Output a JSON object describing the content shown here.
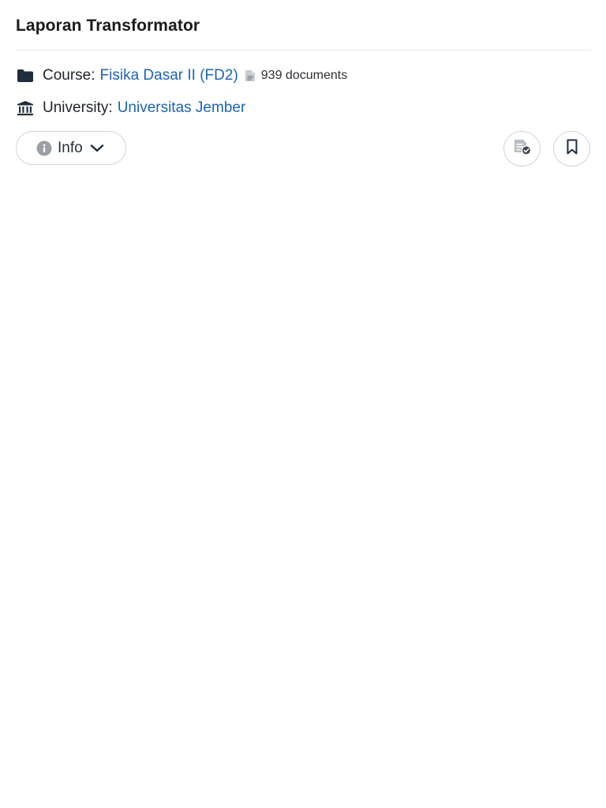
{
  "document": {
    "title": "Laporan Transformator"
  },
  "meta": {
    "course_label": "Course:",
    "course_name": "Fisika Dasar II (FD2)",
    "document_count": "939 documents",
    "university_label": "University:",
    "university_name": "Universitas Jember"
  },
  "actions": {
    "info_label": "Info"
  },
  "icons": {
    "course": "folder-icon",
    "documents": "document-icon",
    "university": "university-icon",
    "info": "info-icon",
    "dropdown": "chevron-down-icon",
    "studylist": "add-to-studylist-icon",
    "save": "bookmark-icon"
  },
  "colors": {
    "link": "#1e63b8",
    "icon_dark": "#1f2d3d",
    "icon_gray": "#9aa0a6",
    "border": "#cfd3d7"
  }
}
